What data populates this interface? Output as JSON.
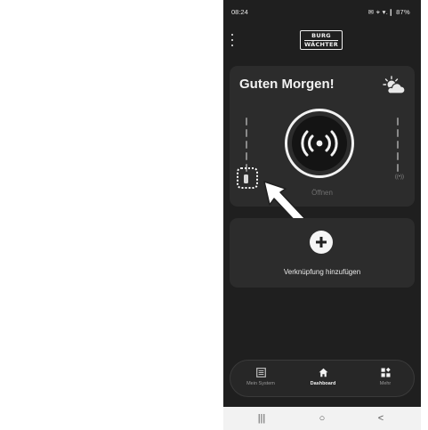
{
  "status_bar": {
    "time": "08:24",
    "icons": "✉ ⌖ ▾.❙ 87%",
    "battery": "87%"
  },
  "app_bar": {
    "menu_icon": "more-vert-icon",
    "logo_line1": "BURG",
    "logo_line2": "WÄCHTER"
  },
  "main_card": {
    "greeting": "Guten Morgen!",
    "weather_icon": "partly-cloudy-icon",
    "open_button_icon": "wireless-signal-icon",
    "open_label": "Öffnen",
    "signal_hint": "((•))"
  },
  "add_card": {
    "icon": "plus-icon",
    "label": "Verknüpfung hinzufügen"
  },
  "bottom_nav": {
    "items": [
      {
        "label": "Mein System",
        "icon": "list-icon",
        "active": false
      },
      {
        "label": "Dashboard",
        "icon": "home-icon",
        "active": true
      },
      {
        "label": "Mehr",
        "icon": "grid-icon",
        "active": false
      }
    ]
  },
  "system_nav": {
    "recents": "|||",
    "home": "○",
    "back": "<"
  },
  "colors": {
    "background": "#1f1f1f",
    "card": "#2c2c2c",
    "text": "#f2f2f2",
    "muted": "#6f6f6f"
  }
}
